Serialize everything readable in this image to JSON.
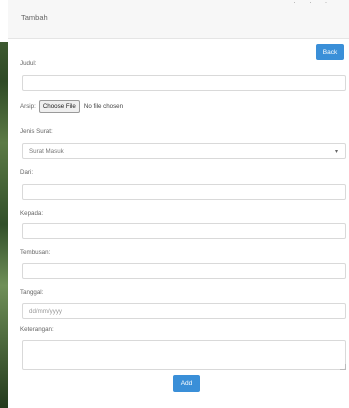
{
  "dialog": {
    "title": "Tambah",
    "back_label": "Back",
    "add_label": "Add"
  },
  "fields": {
    "judul": {
      "label": "Judul:",
      "value": ""
    },
    "arsip": {
      "label": "Arsip:",
      "button": "Choose File",
      "status": "No file chosen"
    },
    "jenis": {
      "label": "Jenis Surat:",
      "selected": "Surat Masuk"
    },
    "dari": {
      "label": "Dari:",
      "value": ""
    },
    "kepada": {
      "label": "Kepada:",
      "value": ""
    },
    "tembusan": {
      "label": "Tembusan:",
      "value": ""
    },
    "tanggal": {
      "label": "Tanggal:",
      "placeholder": "dd/mm/yyyy"
    },
    "keterangan": {
      "label": "Keterangan:",
      "value": ""
    }
  },
  "colors": {
    "accent": "#3a8fd8"
  }
}
